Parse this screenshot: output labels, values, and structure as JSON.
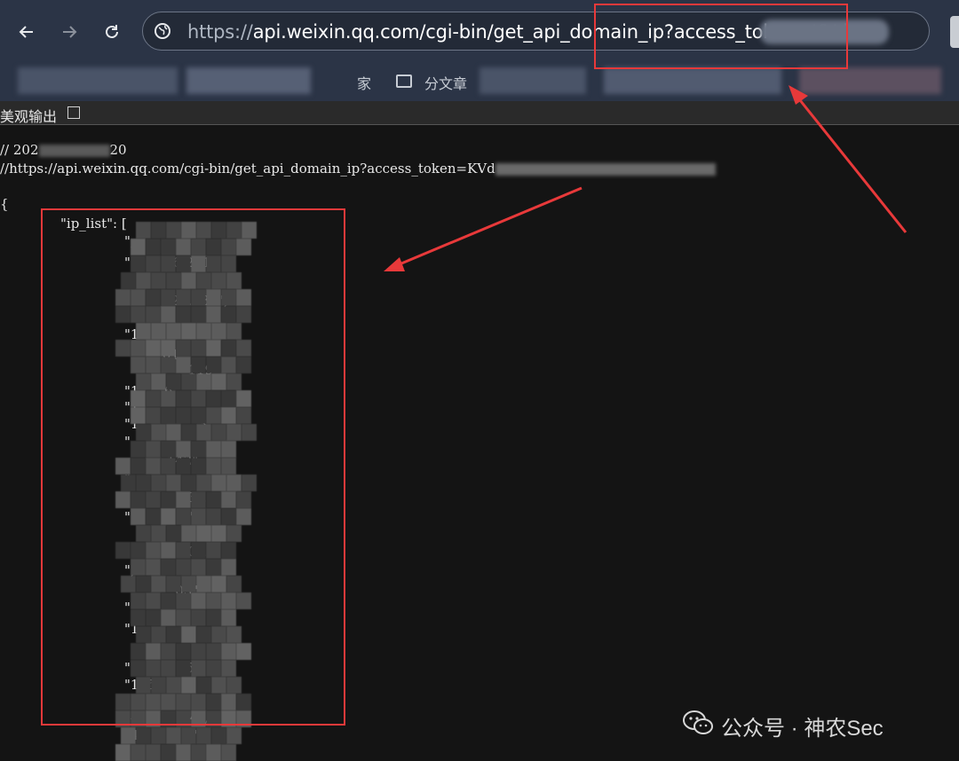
{
  "browser": {
    "url_prefix": "https://",
    "url_main": "api.weixin.qq.com/cgi-bin/get_api_domain_ip?access_token=KVd",
    "icons": [
      "back-arrow-icon",
      "forward-arrow-icon",
      "reload-icon",
      "site-info-icon"
    ]
  },
  "bookmarks": {
    "visible_fragments": [
      "家",
      "分文章"
    ]
  },
  "options": {
    "pretty_print_label": "美观输出"
  },
  "content": {
    "comment_date": "// 202",
    "comment_date_tail": "20",
    "comment_url": "//https://api.weixin.qq.com/cgi-bin/get_api_domain_ip?access_token=KVd",
    "open_brace": "{",
    "ip_list_key": "\"ip_list\": [",
    "ip_fragments": [
      "\",",
      "\"1        6.211\",",
      "\"",
      "         124.186\",",
      "\"",
      "\"1",
      "         01\",",
      "               119\"",
      "\"1      6",
      "\"1              ,",
      "\"1              3\"",
      "\"",
      "          142\",",
      "\",",
      "               3\",",
      "\"1          4\",",
      "             10\",",
      "\",",
      "            05\",",
      "\"",
      "\"1",
      "\"             5\",",
      "\"175.          \"",
      "\"",
      "\"4            4\",",
      "\"4           7\","
    ]
  },
  "watermark": {
    "text": "公众号 · 神农Sec",
    "icon": "wechat-icon"
  },
  "colors": {
    "annotation_red": "#e8393a",
    "toolbar_bg": "#2b3446",
    "page_bg": "#141414"
  }
}
